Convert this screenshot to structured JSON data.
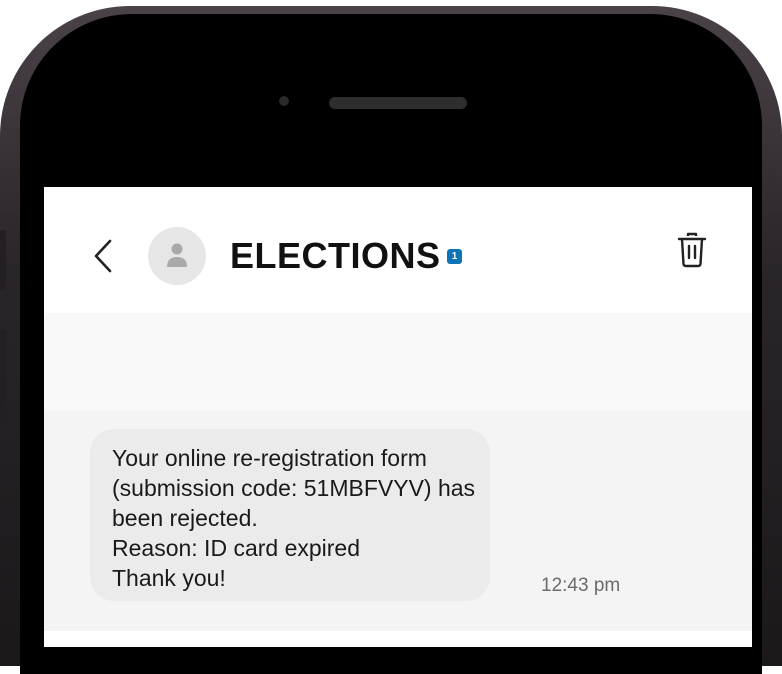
{
  "conversation": {
    "contact_name": "ELECTIONS",
    "verified_badge": "1"
  },
  "message": {
    "lines": [
      "Your online re-registration form",
      "(submission code: 51MBFVYV) has",
      "been rejected.",
      "Reason: ID card expired",
      "Thank you!"
    ],
    "timestamp": "12:43 pm"
  },
  "icons": {
    "back": "back-chevron-icon",
    "avatar": "person-icon",
    "delete": "trash-icon"
  },
  "colors": {
    "badge": "#0d74b5",
    "bubble": "#ebebeb",
    "thread_background": "#f4f4f4"
  }
}
